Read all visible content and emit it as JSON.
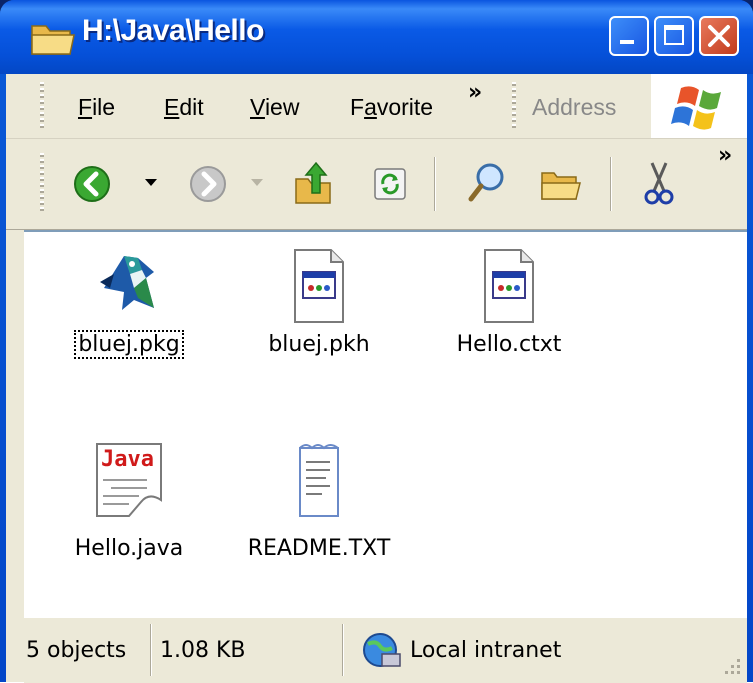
{
  "window": {
    "title": "H:\\Java\\Hello"
  },
  "menubar": {
    "items": [
      {
        "label": "File",
        "accel": "F"
      },
      {
        "label": "Edit",
        "accel": "E"
      },
      {
        "label": "View",
        "accel": "V"
      },
      {
        "label": "Favorite",
        "accel": "a"
      }
    ],
    "overflow": "»",
    "address_label": "Address"
  },
  "toolbar": {
    "overflow": "»",
    "icons": [
      "back-icon",
      "forward-icon",
      "up-folder-icon",
      "sync-icon",
      "search-icon",
      "folders-icon",
      "cut-icon"
    ]
  },
  "files": [
    {
      "name": "bluej.pkg",
      "icon": "bluej-bird-icon",
      "focused": true
    },
    {
      "name": "bluej.pkh",
      "icon": "generic-file-icon",
      "focused": false
    },
    {
      "name": "Hello.ctxt",
      "icon": "generic-file-icon",
      "focused": false
    },
    {
      "name": "Hello.java",
      "icon": "java-file-icon",
      "focused": false,
      "icon_text": "Java"
    },
    {
      "name": "README.TXT",
      "icon": "text-file-icon",
      "focused": false
    }
  ],
  "statusbar": {
    "objects": "5 objects",
    "size": "1.08 KB",
    "zone": "Local intranet"
  },
  "colors": {
    "titlebar": "#0a5ae6",
    "close_button": "#c23b1c",
    "chrome": "#ece9d8"
  }
}
